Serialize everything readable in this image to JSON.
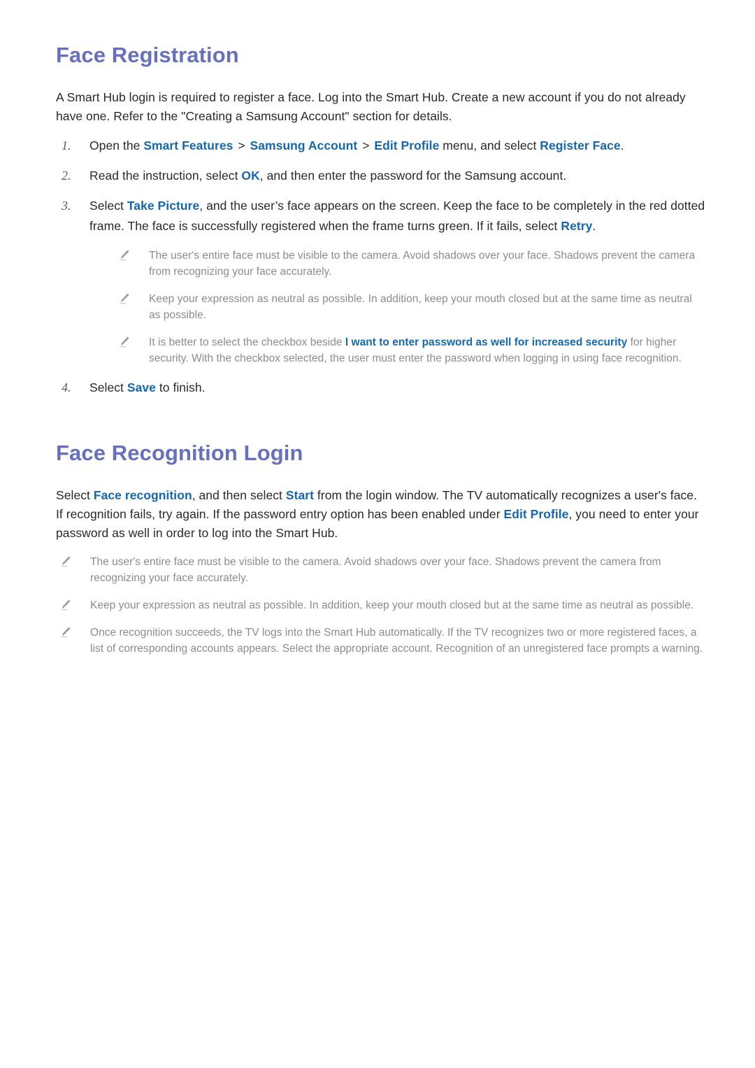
{
  "document": {
    "sections": [
      {
        "id": "face-registration",
        "title": "Face Registration",
        "intro": "A Smart Hub login is required to register a face. Log into the Smart Hub. Create a new account if you do not already have one. Refer to the \"Creating a Samsung Account\" section for details.",
        "steps": [
          {
            "number": "1.",
            "parts": [
              {
                "type": "text",
                "value": "Open the "
              },
              {
                "type": "link",
                "value": "Smart Features"
              },
              {
                "type": "sep",
                "value": ">"
              },
              {
                "type": "link",
                "value": "Samsung Account"
              },
              {
                "type": "sep",
                "value": ">"
              },
              {
                "type": "link",
                "value": "Edit Profile"
              },
              {
                "type": "text",
                "value": " menu, and select "
              },
              {
                "type": "link",
                "value": "Register Face"
              },
              {
                "type": "text",
                "value": "."
              }
            ]
          },
          {
            "number": "2.",
            "parts": [
              {
                "type": "text",
                "value": "Read the instruction, select "
              },
              {
                "type": "link",
                "value": "OK"
              },
              {
                "type": "text",
                "value": ", and then enter the password for the Samsung account."
              }
            ]
          },
          {
            "number": "3.",
            "parts": [
              {
                "type": "text",
                "value": "Select "
              },
              {
                "type": "link",
                "value": "Take Picture"
              },
              {
                "type": "text",
                "value": ", and the user’s face appears on the screen. Keep the face to be completely in the red dotted frame. The face is successfully registered when the frame turns green. If it fails, select "
              },
              {
                "type": "link",
                "value": "Retry"
              },
              {
                "type": "text",
                "value": "."
              }
            ]
          },
          {
            "number": "4.",
            "parts": [
              {
                "type": "text",
                "value": "Select "
              },
              {
                "type": "link",
                "value": "Save"
              },
              {
                "type": "text",
                "value": " to finish."
              }
            ]
          }
        ],
        "notes": [
          {
            "icon": "pencil-icon",
            "parts": [
              {
                "type": "text",
                "value": "The user's entire face must be visible to the camera. Avoid shadows over your face. Shadows prevent the camera from recognizing your face accurately."
              }
            ]
          },
          {
            "icon": "pencil-icon",
            "parts": [
              {
                "type": "text",
                "value": "Keep your expression as neutral as possible. In addition, keep your mouth closed but at the same time as neutral as possible."
              }
            ]
          },
          {
            "icon": "pencil-icon",
            "parts": [
              {
                "type": "text",
                "value": "It is better to select the checkbox beside "
              },
              {
                "type": "link",
                "value": "I want to enter password as well for increased security"
              },
              {
                "type": "text",
                "value": " for higher security. With the checkbox selected, the user must enter the password when logging in using face recognition."
              }
            ]
          }
        ]
      },
      {
        "id": "face-recognition-login",
        "title": "Face Recognition Login",
        "intro_parts": [
          {
            "type": "text",
            "value": "Select "
          },
          {
            "type": "link",
            "value": "Face recognition"
          },
          {
            "type": "text",
            "value": ", and then select "
          },
          {
            "type": "link",
            "value": "Start"
          },
          {
            "type": "text",
            "value": " from the login window. The TV automatically recognizes a user's face. If recognition fails, try again. If the password entry option has been enabled under "
          },
          {
            "type": "link",
            "value": "Edit Profile"
          },
          {
            "type": "text",
            "value": ", you need to enter your password as well in order to log into the Smart Hub."
          }
        ],
        "notes": [
          {
            "icon": "pencil-icon",
            "parts": [
              {
                "type": "text",
                "value": "The user's entire face must be visible to the camera. Avoid shadows over your face. Shadows prevent the camera from recognizing your face accurately."
              }
            ]
          },
          {
            "icon": "pencil-icon",
            "parts": [
              {
                "type": "text",
                "value": "Keep your expression as neutral as possible. In addition, keep your mouth closed but at the same time as neutral as possible."
              }
            ]
          },
          {
            "icon": "pencil-icon",
            "parts": [
              {
                "type": "text",
                "value": "Once recognition succeeds, the TV logs into the Smart Hub automatically. If the TV recognizes two or more registered faces, a list of corresponding accounts appears. Select the appropriate account. Recognition of an unregistered face prompts a warning."
              }
            ]
          }
        ]
      }
    ],
    "colors": {
      "heading": "#6670BE",
      "link": "#1568AF",
      "body_text": "#29292B",
      "note_text": "#8C8C8E",
      "background": "#FFFFFF"
    }
  }
}
